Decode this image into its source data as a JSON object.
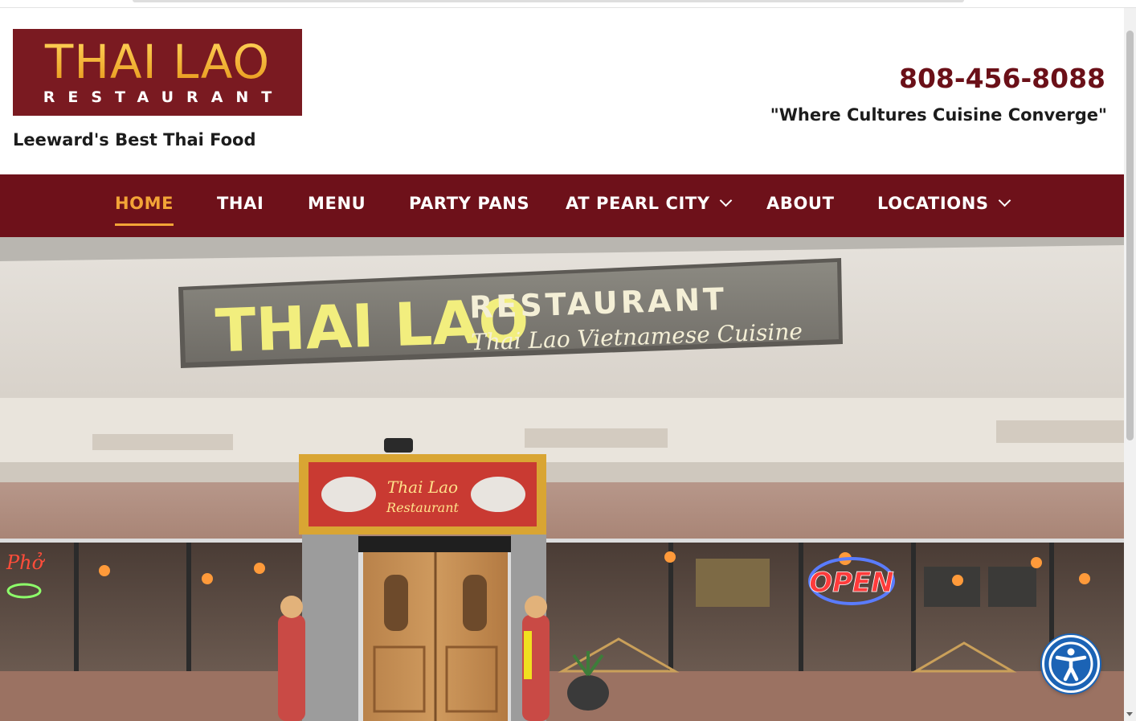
{
  "site": {
    "logo_main": "THAI LAO",
    "logo_sub": "RESTAURANT",
    "tagline_left": "Leeward's Best Thai Food",
    "phone": "808-456-8088",
    "tagline_right": "\"Where Cultures Cuisine Converge\""
  },
  "nav": {
    "items": [
      {
        "label": "HOME",
        "active": true,
        "has_dropdown": false
      },
      {
        "label": "THAI",
        "active": false,
        "has_dropdown": false
      },
      {
        "label": "MENU",
        "active": false,
        "has_dropdown": false
      },
      {
        "label": "PARTY PANS",
        "active": false,
        "has_dropdown": false
      },
      {
        "label": "AT PEARL CITY",
        "active": false,
        "has_dropdown": true
      },
      {
        "label": "ABOUT",
        "active": false,
        "has_dropdown": false
      },
      {
        "label": "LOCATIONS",
        "active": false,
        "has_dropdown": true
      }
    ]
  },
  "hero": {
    "sign_name": "THAI LAO",
    "sign_restaurant": "RESTAURANT",
    "sign_cuisine": "Thai Lao Vietnamese Cuisine",
    "banner_line1": "Thai Lao",
    "banner_line2": "Restaurant",
    "open_sign": "OPEN",
    "pho_sign": "Phở"
  },
  "colors": {
    "brand": "#6e111a",
    "accent": "#f3a437",
    "logo_bg": "#7a1a21",
    "accessibility_button": "#1b63b5"
  },
  "icons": {
    "dropdown": "chevron-down-icon",
    "accessibility": "accessibility-icon"
  }
}
